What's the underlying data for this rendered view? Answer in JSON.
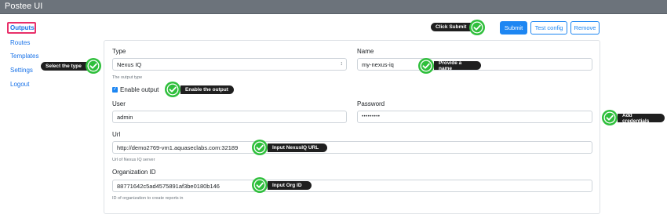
{
  "app": {
    "title": "Postee UI"
  },
  "sidebar": {
    "items": [
      {
        "label": "Outputs",
        "active": true
      },
      {
        "label": "Routes"
      },
      {
        "label": "Templates"
      },
      {
        "label": "Settings"
      },
      {
        "label": "Logout"
      }
    ]
  },
  "toolbar": {
    "submit_label": "Submit",
    "test_config_label": "Test config",
    "remove_label": "Remove"
  },
  "form": {
    "type_label": "Type",
    "type_value": "Nexus IQ",
    "type_help": "The output type",
    "name_label": "Name",
    "name_value": "my-nexus-iq",
    "enable_label": "Enable output",
    "enable_checked": true,
    "user_label": "User",
    "user_value": "admin",
    "password_label": "Password",
    "password_value": "•••••••••",
    "url_label": "Url",
    "url_value": "http://demo2769-vm1.aquaseclabs.com:32189",
    "url_help": "Url of Nexus IQ server",
    "org_label": "Organization ID",
    "org_value": "88771642c5ad4575891af3be0180b146",
    "org_help": "ID of organization to create reports in"
  },
  "annotations": {
    "click_submit": "Click Submit",
    "select_type": "Select the type",
    "provide_name": "Provide a name",
    "enable_output": "Enable the output",
    "add_credentials": "Add credentials",
    "input_url": "Input NexusIQ URL",
    "input_org": "Input Org ID"
  },
  "colors": {
    "topbar": "#6c737b",
    "primary": "#1d86f2",
    "active_outline": "#e8306a",
    "annotation_green": "#2fbf3c",
    "annotation_bg": "#1f1f1f"
  }
}
